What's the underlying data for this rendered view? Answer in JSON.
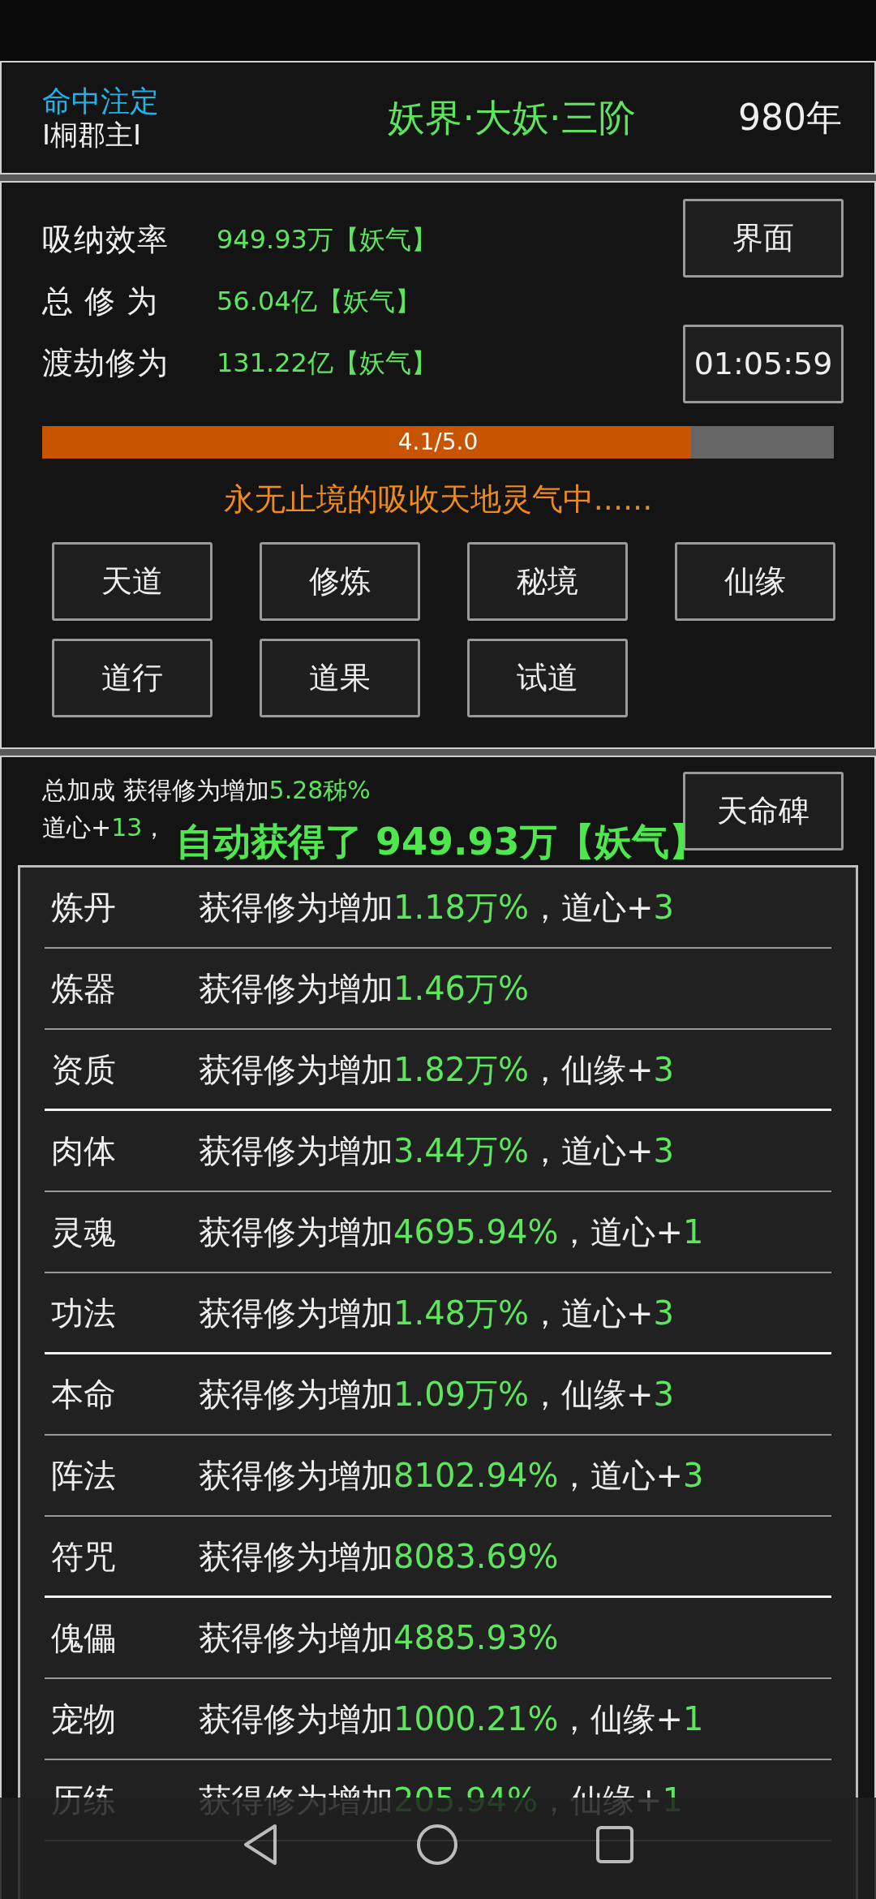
{
  "header": {
    "fate": "命中注定",
    "title_name": "I桐郡主I",
    "realm": "妖界·大妖·三阶",
    "years": "980年"
  },
  "stats": [
    {
      "label": "吸纳效率",
      "value": "949.93万【妖气】"
    },
    {
      "label": "总 修 为",
      "value": "56.04亿【妖气】"
    },
    {
      "label": "渡劫修为",
      "value": "131.22亿【妖气】"
    }
  ],
  "interface_button": "界面",
  "timer": "01:05:59",
  "progress": {
    "level": 0.82,
    "label": "4.1/5.0"
  },
  "status_message": "永无止境的吸收天地灵气中......",
  "menu_buttons": [
    "天道",
    "修炼",
    "秘境",
    "仙缘",
    "道行",
    "道果",
    "试道"
  ],
  "bonus": {
    "label": "总加成 获得修为增加",
    "value": "5.28秭%",
    "line2_label": "道心+",
    "line2_value": "13",
    "line2_tail": "，"
  },
  "fate_stele_button": "天命碑",
  "toast": "自动获得了 949.93万【妖气】",
  "rows": [
    {
      "name": "炼丹",
      "label": "获得修为增加",
      "value": "1.18万%",
      "extra_label": "，道心+",
      "extra_value": "3",
      "group_end": false
    },
    {
      "name": "炼器",
      "label": "获得修为增加",
      "value": "1.46万%",
      "group_end": false
    },
    {
      "name": "资质",
      "label": "获得修为增加",
      "value": "1.82万%",
      "extra_label": "，仙缘+",
      "extra_value": "3",
      "group_end": true
    },
    {
      "name": "肉体",
      "label": "获得修为增加",
      "value": "3.44万%",
      "extra_label": "，道心+",
      "extra_value": "3",
      "group_end": false
    },
    {
      "name": "灵魂",
      "label": "获得修为增加",
      "value": "4695.94%",
      "extra_label": "，道心+",
      "extra_value": "1",
      "group_end": false
    },
    {
      "name": "功法",
      "label": "获得修为增加",
      "value": "1.48万%",
      "extra_label": "，道心+",
      "extra_value": "3",
      "group_end": true
    },
    {
      "name": "本命",
      "label": "获得修为增加",
      "value": "1.09万%",
      "extra_label": "，仙缘+",
      "extra_value": "3",
      "group_end": false
    },
    {
      "name": "阵法",
      "label": "获得修为增加",
      "value": "8102.94%",
      "extra_label": "，道心+",
      "extra_value": "3",
      "group_end": false
    },
    {
      "name": "符咒",
      "label": "获得修为增加",
      "value": "8083.69%",
      "group_end": true
    },
    {
      "name": "傀儡",
      "label": "获得修为增加",
      "value": "4885.93%",
      "group_end": false
    },
    {
      "name": "宠物",
      "label": "获得修为增加",
      "value": "1000.21%",
      "extra_label": "，仙缘+",
      "extra_value": "1",
      "group_end": false
    },
    {
      "name": "历练",
      "label": "获得修为增加",
      "value": "205.94%",
      "extra_label": "，仙缘+",
      "extra_value": "1",
      "group_end": false
    }
  ]
}
